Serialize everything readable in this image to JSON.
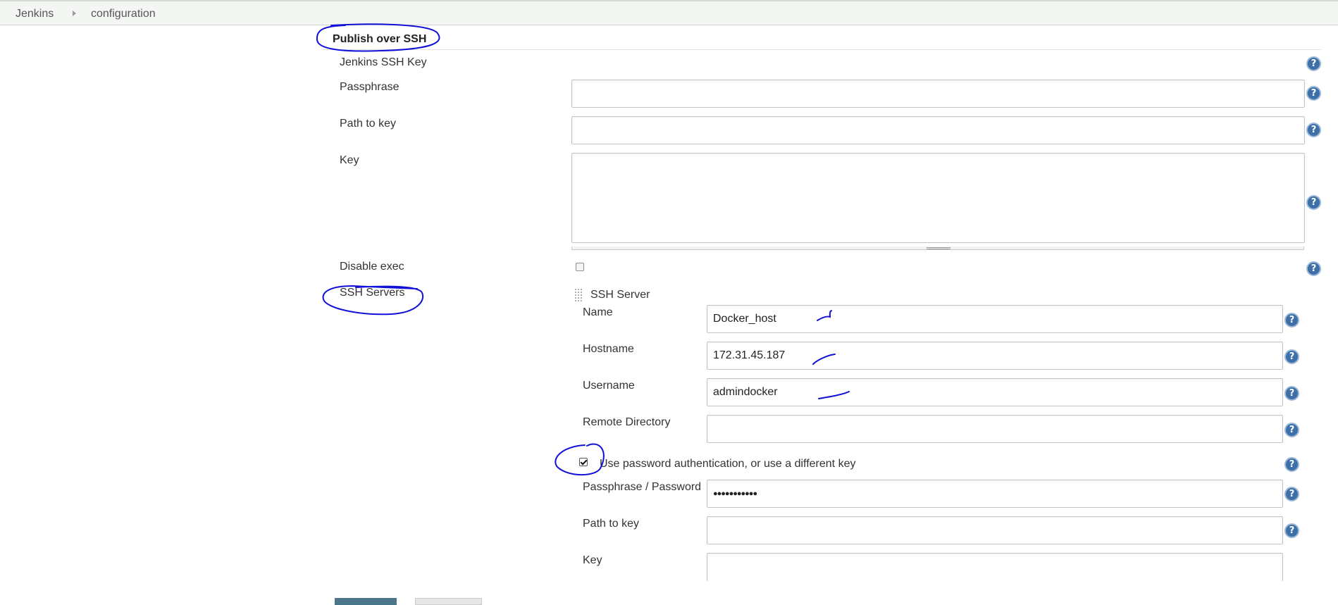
{
  "breadcrumb": {
    "items": [
      "Jenkins",
      "configuration"
    ]
  },
  "section": {
    "title": "Publish over SSH"
  },
  "global": {
    "jenkins_ssh_key_label": "Jenkins SSH Key",
    "passphrase_label": "Passphrase",
    "passphrase_value": "",
    "path_to_key_label": "Path to key",
    "path_to_key_value": "",
    "key_label": "Key",
    "key_value": "",
    "disable_exec_label": "Disable exec",
    "disable_exec_checked": false,
    "ssh_servers_label": "SSH Servers"
  },
  "server": {
    "header": "SSH Server",
    "name_label": "Name",
    "name_value": "Docker_host",
    "hostname_label": "Hostname",
    "hostname_value": "172.31.45.187",
    "username_label": "Username",
    "username_value": "admindocker",
    "remote_dir_label": "Remote Directory",
    "remote_dir_value": "",
    "use_password_label": "Use password authentication, or use a different key",
    "use_password_checked": true,
    "passphrase_password_label": "Passphrase / Password",
    "passphrase_password_value": "●●●●●●●●●●●",
    "path_to_key_label": "Path to key",
    "path_to_key_value": "",
    "key_label": "Key",
    "key_value": ""
  },
  "help_glyph": "?",
  "colors": {
    "annotation_ink": "#1010d8",
    "help_icon": "#3d6fa8",
    "topbar_bg": "#f4f6f4",
    "button_primary": "#4b758b"
  }
}
